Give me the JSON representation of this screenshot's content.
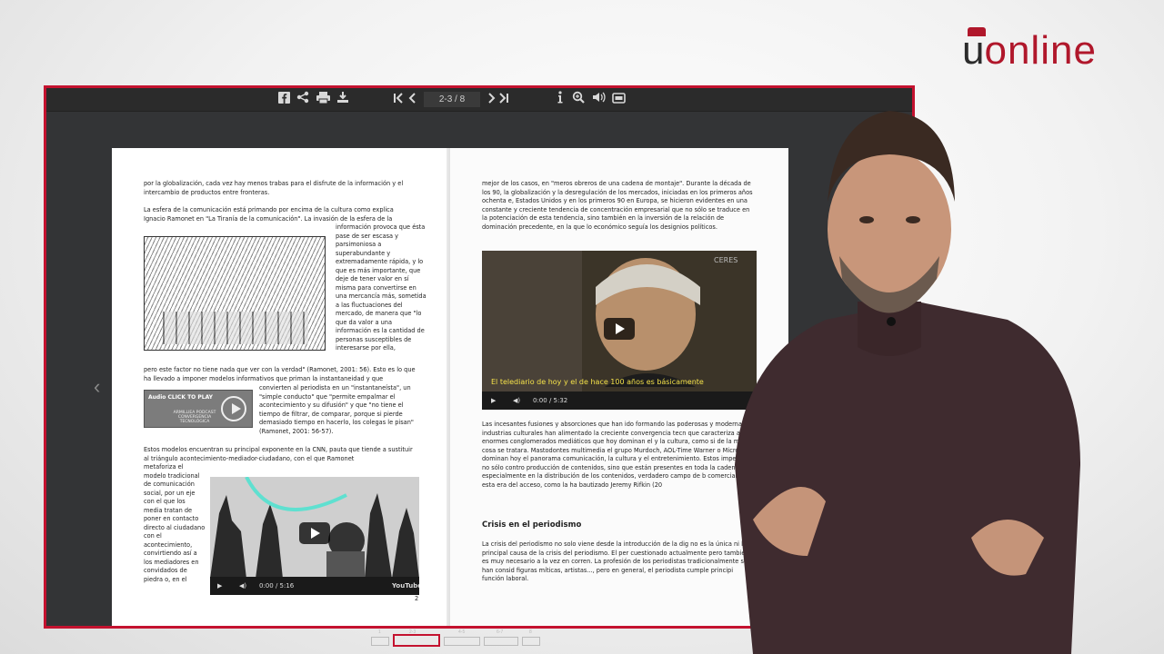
{
  "brand": {
    "logo_u": "u",
    "logo_text": "online",
    "accent": "#b0172b"
  },
  "viewer": {
    "page_indicator": "2-3 / 8",
    "toolbar_icons": [
      "facebook-icon",
      "share-icon",
      "print-icon",
      "download-icon",
      "first-page-icon",
      "prev-page-icon",
      "next-page-icon",
      "last-page-icon",
      "info-icon",
      "zoom-icon",
      "sound-icon",
      "fullscreen-icon"
    ],
    "frame_color": "#c4122f"
  },
  "left_page": {
    "p1_bold": "globalización",
    "p1": "por la globalización, cada vez hay menos trabas para el disfrute de la información y el intercambio de productos entre fronteras.",
    "p2": "La esfera de la comunicación está primando por encima de la cultura como explica Ignacio Ramonet en \"La Tiranía de la comunicación\". La invasión de la esfera de la",
    "p3": "información provoca que ésta pase de ser escasa y parsimoniosa a superabundante y extremadamente rápida, y lo que es más importante, que deje de tener valor en sí misma para convertirse en una mercancía más, sometida a las fluctuaciones del mercado, de manera que \"lo que da valor a una información es la cantidad de personas susceptibles de interesarse por ella,",
    "p4": "pero este factor no tiene nada que ver con la verdad\" (Ramonet, 2001: 56). Esto es lo que ha llevado a imponer modelos informativos que priman la instantaneidad y que",
    "p5": "convierten al periodista en un \"instantaneísta\", un \"simple conducto\" que \"permite empalmar el acontecimiento y su difusión\" y que \"no tiene el tiempo de filtrar, de comparar, porque si pierde demasiado tiempo en hacerlo, los colegas le pisan\" (Ramonet, 2001: 56-57).",
    "p6": "Estos modelos encuentran su principal exponente en la CNN, pauta que tiende a sustituir al triángulo acontecimiento-mediador-ciudadano, con el que Ramonet",
    "p7": "metaforiza el modelo tradicional de comunicación social, por un eje con el que los media tratan de poner en contacto directo al ciudadano con el acontecimiento, convirtiendo así a los mediadores en convidados de piedra o, en el",
    "audio_label": "Audio CLICK TO PLAY",
    "audio_sub": "ARMILLIEA PODCAST CONVERGENCIA TECNOLÓGICA",
    "video_time": "0:00 / 5:16",
    "page_number": "2"
  },
  "right_page": {
    "p1": "mejor de los casos, en \"meros obreros de una cadena de montaje\". Durante la década de los 90, la globalización y la desregulación de los mercados, iniciadas en los primeros años ochenta e, Estados Unidos y en los primeros 90 en Europa, se hicieron evidentes en una constante y creciente tendencia de concentración empresarial que no sólo se traduce en la potenciación de esta tendencia, sino también en la inversión de la relación de dominación precedente, en la que lo económico seguía los designios políticos.",
    "video_caption": "El telediario de hoy y el de hace 100 años es básicamente",
    "video_time": "0:00 / 5:32",
    "video_watermark": "CERES",
    "p2": "Las incesantes fusiones y absorciones que han ido formando las poderosas y modernas industrias culturales han alimentado la creciente convergencia tecn que caracteriza a los enormes conglomerados mediáticos que hoy dominan el y la cultura, como si de la misma cosa se tratara. Mastodontes multimedia el grupo Murdoch, AOL-Time Warner o Microsoft dominan hoy el panorama comunicación, la cultura y el entretenimiento. Estos imperios no sólo contro producción de contenidos, sino que están presentes en toda la cadena me especialmente en la distribución de los contenidos, verdadero campo de b comercial en esta era del acceso, como la ha bautizado Jeremy Rifkin (20",
    "heading": "Crisis en el periodismo",
    "p3": "La crisis del periodismo no solo viene desde la introducción de la dig no es la única ni la principal causa de la crisis del periodismo. El per cuestionado actualmente pero también es muy necesario a la vez en corren. La profesión de los periodistas tradicionalmente se han consid figuras míticas, artistas..., pero en general, el periodista cumple principi función laboral."
  },
  "thumbnails": [
    "1",
    "2-3",
    "4-5",
    "6-7",
    "8"
  ]
}
